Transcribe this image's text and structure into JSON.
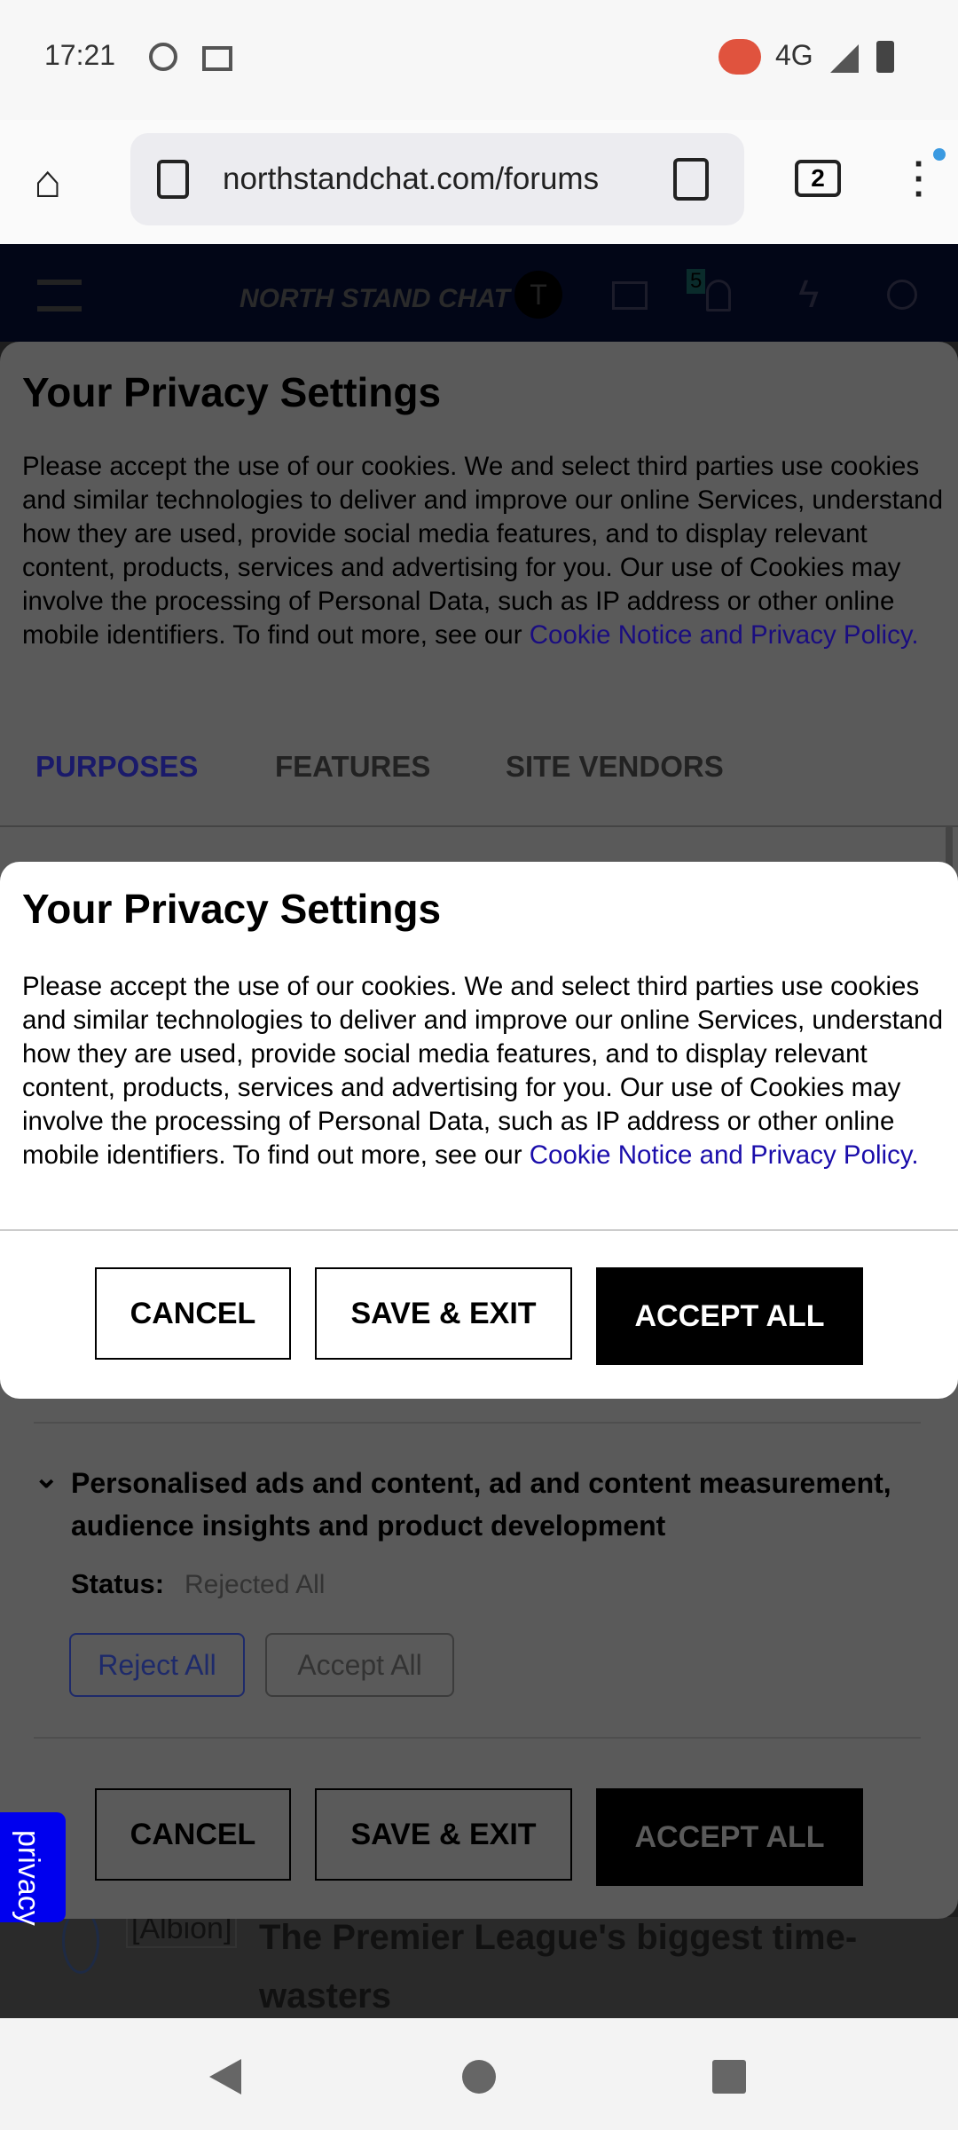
{
  "status_bar": {
    "time": "17:21",
    "network": "4G"
  },
  "browser": {
    "url": "northstandchat.com/forums",
    "tab_count": "2"
  },
  "site_header": {
    "logo": "NORTH STAND CHAT",
    "avatar_letter": "T",
    "notification_count": "5"
  },
  "privacy_back": {
    "title": "Your Privacy Settings",
    "body": "Please accept the use of our cookies. We and select third parties use cookies and similar technologies to deliver and improve our online Services, understand how they are used, provide social media features, and to display relevant content, products, services and advertising for you. Our use of Cookies may involve the processing of Personal Data, such as IP address or other online mobile identifiers. To find out more, see our ",
    "link": "Cookie Notice and Privacy Policy.",
    "tabs": [
      "PURPOSES",
      "FEATURES",
      "SITE VENDORS"
    ],
    "purpose": {
      "label": "Personalised ads and content, ad and content measurement, audience insights and product development",
      "status_label": "Status:",
      "status_value": "Rejected All",
      "reject": "Reject All",
      "accept": "Accept All"
    },
    "buttons": {
      "cancel": "CANCEL",
      "save": "SAVE & EXIT",
      "accept": "ACCEPT ALL"
    }
  },
  "privacy_front": {
    "title": "Your Privacy Settings",
    "body": "Please accept the use of our cookies. We and select third parties use cookies and similar technologies to deliver and improve our online Services, understand how they are used, provide social media features, and to display relevant content, products, services and advertising for you. Our use of Cookies may involve the processing of Personal Data, such as IP address or other online mobile identifiers. To find out more, see our ",
    "link": "Cookie Notice and Privacy Policy.",
    "buttons": {
      "cancel": "CANCEL",
      "save": "SAVE & EXIT",
      "accept": "ACCEPT ALL"
    }
  },
  "privacy_tab": "privacy",
  "thread": {
    "tag": "[Albion]",
    "title": "The Premier League's biggest time-wasters"
  },
  "colors": {
    "accent": "#1a0dab",
    "privacy_tab": "#0000ee"
  }
}
